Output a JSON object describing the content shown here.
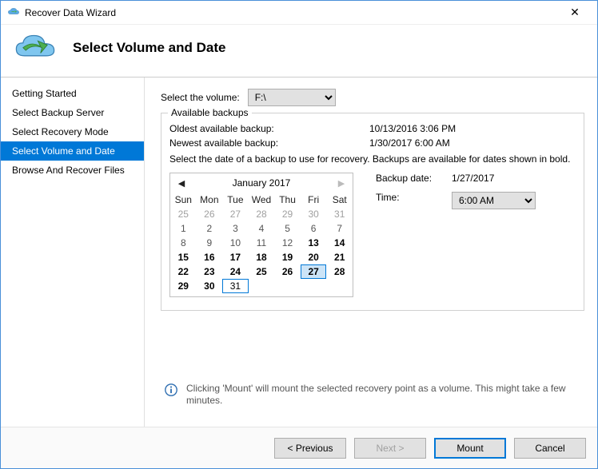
{
  "window": {
    "title": "Recover Data Wizard"
  },
  "header": {
    "title": "Select Volume and Date"
  },
  "nav": {
    "items": [
      {
        "label": "Getting Started",
        "selected": false
      },
      {
        "label": "Select Backup Server",
        "selected": false
      },
      {
        "label": "Select Recovery Mode",
        "selected": false
      },
      {
        "label": "Select Volume and Date",
        "selected": true
      },
      {
        "label": "Browse And Recover Files",
        "selected": false
      }
    ]
  },
  "main": {
    "select_volume_label": "Select the volume:",
    "volume": "F:\\",
    "fieldset_title": "Available backups",
    "oldest_label": "Oldest available backup:",
    "oldest_value": "10/13/2016 3:06 PM",
    "newest_label": "Newest available backup:",
    "newest_value": "1/30/2017 6:00 AM",
    "instruction": "Select the date of a backup to use for recovery. Backups are available for dates shown in bold.",
    "backup_date_label": "Backup date:",
    "backup_date_value": "1/27/2017",
    "time_label": "Time:",
    "time_value": "6:00 AM"
  },
  "calendar": {
    "month_label": "January 2017",
    "dow": [
      "Sun",
      "Mon",
      "Tue",
      "Wed",
      "Thu",
      "Fri",
      "Sat"
    ],
    "days": [
      {
        "n": "25",
        "gray": true
      },
      {
        "n": "26",
        "gray": true
      },
      {
        "n": "27",
        "gray": true
      },
      {
        "n": "28",
        "gray": true
      },
      {
        "n": "29",
        "gray": true
      },
      {
        "n": "30",
        "gray": true
      },
      {
        "n": "31",
        "gray": true
      },
      {
        "n": "1"
      },
      {
        "n": "2"
      },
      {
        "n": "3"
      },
      {
        "n": "4"
      },
      {
        "n": "5"
      },
      {
        "n": "6"
      },
      {
        "n": "7"
      },
      {
        "n": "8"
      },
      {
        "n": "9"
      },
      {
        "n": "10"
      },
      {
        "n": "11"
      },
      {
        "n": "12"
      },
      {
        "n": "13",
        "bold": true
      },
      {
        "n": "14",
        "bold": true
      },
      {
        "n": "15",
        "bold": true
      },
      {
        "n": "16",
        "bold": true
      },
      {
        "n": "17",
        "bold": true
      },
      {
        "n": "18",
        "bold": true
      },
      {
        "n": "19",
        "bold": true
      },
      {
        "n": "20",
        "bold": true
      },
      {
        "n": "21",
        "bold": true
      },
      {
        "n": "22",
        "bold": true
      },
      {
        "n": "23",
        "bold": true
      },
      {
        "n": "24",
        "bold": true
      },
      {
        "n": "25",
        "bold": true
      },
      {
        "n": "26",
        "bold": true
      },
      {
        "n": "27",
        "bold": true,
        "selected": true
      },
      {
        "n": "28",
        "bold": true
      },
      {
        "n": "29",
        "bold": true
      },
      {
        "n": "30",
        "bold": true
      },
      {
        "n": "31",
        "today": true
      }
    ]
  },
  "info": {
    "text": "Clicking 'Mount' will mount the selected recovery point as a volume. This might take a few minutes."
  },
  "buttons": {
    "previous": "< Previous",
    "next": "Next >",
    "mount": "Mount",
    "cancel": "Cancel"
  }
}
